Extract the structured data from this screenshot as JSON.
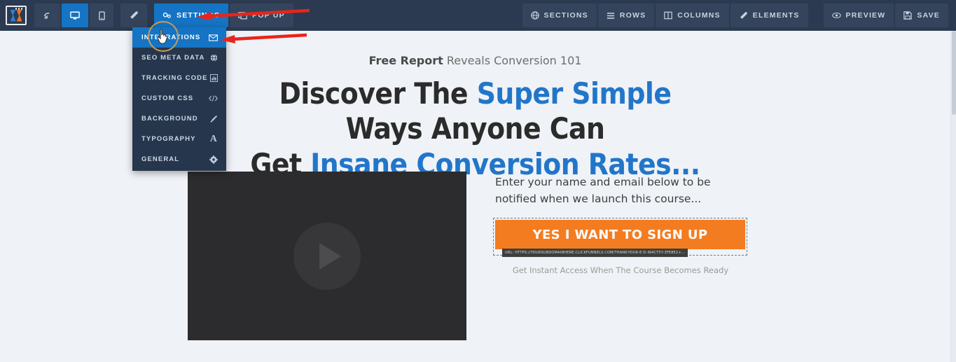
{
  "toolbar": {
    "logo_name": "clickfunnels-logo",
    "left_buttons": [
      {
        "name": "undo-button",
        "icon": "undo-arrow-icon",
        "label": "",
        "active": false
      },
      {
        "name": "desktop-view-button",
        "icon": "desktop-icon",
        "label": "",
        "active": true
      },
      {
        "name": "mobile-view-button",
        "icon": "mobile-icon",
        "label": "",
        "active": false
      },
      {
        "name": "magic-wand-button",
        "icon": "magic-wand-icon",
        "label": "",
        "active": false
      }
    ],
    "settings_tab": {
      "label": "SETTINGS",
      "icon": "settings-gears-icon",
      "active": true
    },
    "popup_tab": {
      "label": "POP UP",
      "icon": "popup-icon",
      "active": false
    },
    "right_buttons": [
      {
        "name": "sections-button",
        "label": "SECTIONS",
        "icon": "globe-icon"
      },
      {
        "name": "rows-button",
        "label": "ROWS",
        "icon": "rows-icon"
      },
      {
        "name": "columns-button",
        "label": "COLUMNS",
        "icon": "columns-icon"
      },
      {
        "name": "elements-button",
        "label": "ELEMENTS",
        "icon": "magic-wand-icon"
      }
    ],
    "action_buttons": [
      {
        "name": "preview-button",
        "label": "PREVIEW",
        "icon": "eye-icon"
      },
      {
        "name": "save-button",
        "label": "SAVE",
        "icon": "save-disk-icon"
      }
    ]
  },
  "settings_menu": {
    "items": [
      {
        "label": "INTEGRATIONS",
        "icon": "envelope-icon",
        "selected": true
      },
      {
        "label": "SEO META DATA",
        "icon": "globe-icon",
        "selected": false
      },
      {
        "label": "TRACKING CODE",
        "icon": "bar-chart-icon",
        "selected": false
      },
      {
        "label": "CUSTOM CSS",
        "icon": "code-icon",
        "selected": false
      },
      {
        "label": "BACKGROUND",
        "icon": "paintbrush-icon",
        "selected": false
      },
      {
        "label": "TYPOGRAPHY",
        "icon": "letter-a-icon",
        "selected": false
      },
      {
        "label": "GENERAL",
        "icon": "gear-icon",
        "selected": false
      }
    ]
  },
  "page": {
    "preheadline_bold": "Free Report",
    "preheadline_rest": " Reveals Conversion 101",
    "headline_1a": "Discover The ",
    "headline_1b": "Super Simple",
    "headline_1c": " Ways Anyone Can",
    "headline_2a": "Get ",
    "headline_2b": "Insane Conversion Rates...",
    "video_placeholder": "video-player",
    "form_lead": "Enter your name and email below to be notified when we launch this course...",
    "cta_label": "YES I WANT TO SIGN UP",
    "cta_url_tooltip": "URL: HTTPS://YOURSUBDOMAINHERE.CLICKFUNNELS.COM/THANK-YOUR-E-D-IN4CT5Y-3FE8E2+...",
    "cta_subtext": "Get Instant Access When The Course Becomes Ready"
  },
  "colors": {
    "toolbar_bg": "#2b3a50",
    "accent_blue": "#1574c4",
    "menu_bg": "#26364d",
    "headline_blue": "#2276c9",
    "cta_orange": "#f47c20",
    "canvas_bg": "#eff2f6",
    "annotation_red": "#e8251a"
  }
}
